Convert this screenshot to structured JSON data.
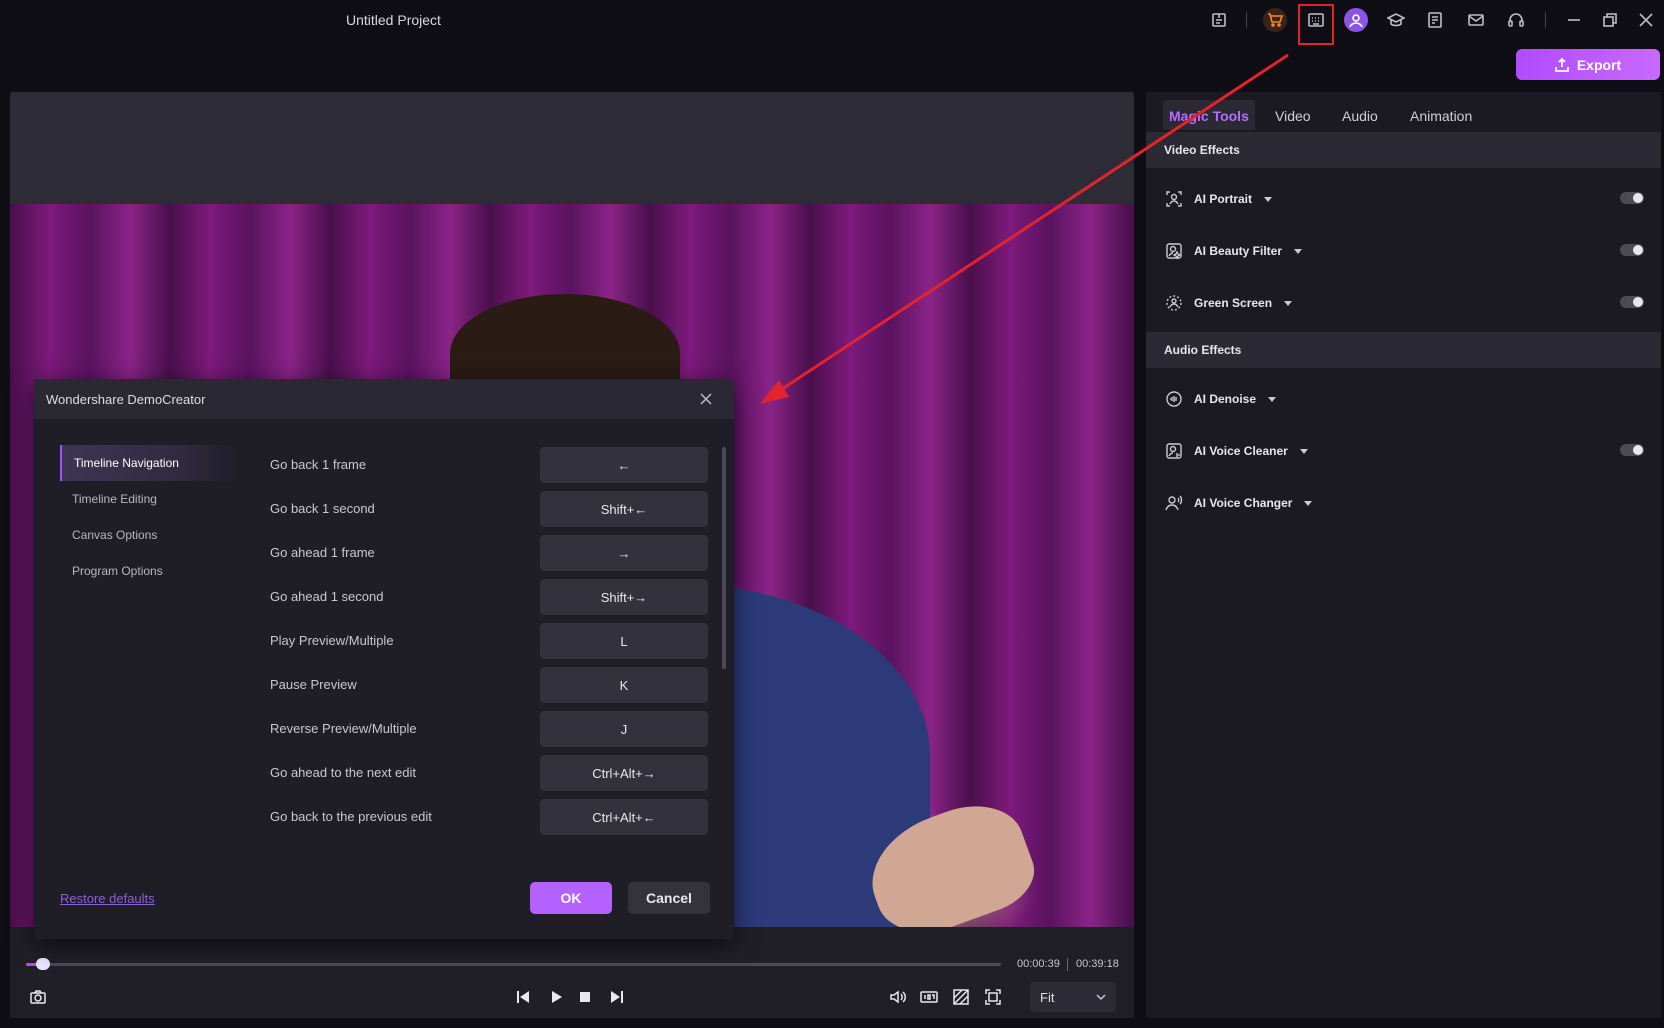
{
  "titlebar": {
    "project_title": "Untitled Project",
    "icons": [
      "publish-icon",
      "cart-icon",
      "keyboard-shortcuts-icon",
      "account-avatar",
      "learn-icon",
      "task-icon",
      "mail-icon",
      "support-icon",
      "minimize-icon",
      "restore-icon",
      "close-icon"
    ]
  },
  "export": {
    "label": "Export"
  },
  "right_panel": {
    "tabs": [
      {
        "label": "Magic Tools",
        "active": true
      },
      {
        "label": "Video",
        "active": false
      },
      {
        "label": "Audio",
        "active": false
      },
      {
        "label": "Animation",
        "active": false
      }
    ],
    "video_effects_title": "Video Effects",
    "video_effects": [
      {
        "label": "AI Portrait",
        "toggle": false
      },
      {
        "label": "AI Beauty Filter",
        "toggle": false
      },
      {
        "label": "Green Screen",
        "toggle": false
      }
    ],
    "audio_effects_title": "Audio Effects",
    "audio_effects": [
      {
        "label": "AI Denoise"
      },
      {
        "label": "AI Voice Cleaner",
        "toggle": false
      },
      {
        "label": "AI Voice Changer"
      }
    ]
  },
  "player": {
    "time_current": "00:00:39",
    "time_total": "00:39:18",
    "fit_value": "Fit",
    "progress": 0.017
  },
  "dialog": {
    "title": "Wondershare DemoCreator",
    "categories": [
      {
        "label": "Timeline Navigation",
        "active": true
      },
      {
        "label": "Timeline Editing",
        "active": false
      },
      {
        "label": "Canvas Options",
        "active": false
      },
      {
        "label": "Program Options",
        "active": false
      }
    ],
    "shortcuts": [
      {
        "action": "Go back 1 frame",
        "key": "←"
      },
      {
        "action": "Go back 1 second",
        "key": "Shift+←"
      },
      {
        "action": "Go ahead 1 frame",
        "key": "→"
      },
      {
        "action": "Go ahead 1 second",
        "key": "Shift+→"
      },
      {
        "action": "Play Preview/Multiple",
        "key": "L"
      },
      {
        "action": "Pause Preview",
        "key": "K"
      },
      {
        "action": "Reverse Preview/Multiple",
        "key": "J"
      },
      {
        "action": "Go ahead to the next edit",
        "key": "Ctrl+Alt+→"
      },
      {
        "action": "Go back to the previous edit",
        "key": "Ctrl+Alt+←"
      }
    ],
    "restore_label": "Restore defaults",
    "ok_label": "OK",
    "cancel_label": "Cancel"
  },
  "colors": {
    "accent": "#b14bff",
    "annotation_red": "#e2232b"
  }
}
